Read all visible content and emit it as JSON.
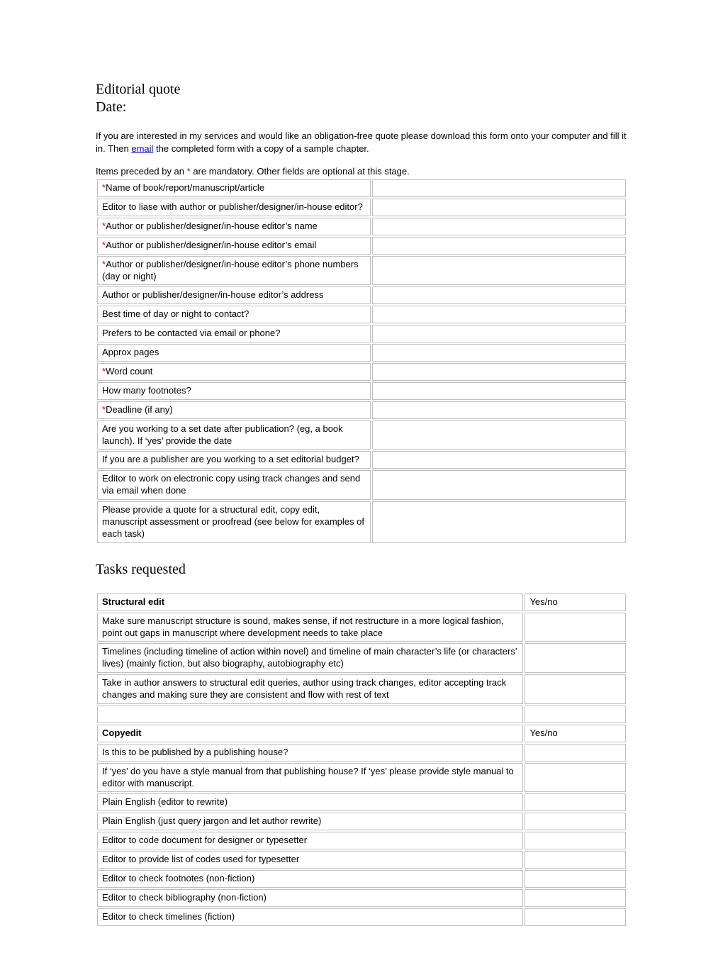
{
  "header": {
    "title": "Editorial quote",
    "date_label": "Date:"
  },
  "intro": {
    "text_before": "If you are interested in my services and would like an obligation-free quote please download this form onto your computer and fill it in. Then ",
    "link_text": "email",
    "text_after": " the completed form with a copy of a sample chapter."
  },
  "mandatory": {
    "before": "Items preceded by an ",
    "mark": "*",
    "after": " are mandatory. Other fields are optional at this stage."
  },
  "form_rows": [
    {
      "mandatory": true,
      "label": "Name of book/report/manuscript/article",
      "value": ""
    },
    {
      "mandatory": false,
      "label": "Editor to liase with author or publisher/designer/in-house editor?",
      "value": ""
    },
    {
      "mandatory": true,
      "label": "Author or publisher/designer/in-house editor’s name",
      "value": ""
    },
    {
      "mandatory": true,
      "label": "Author or publisher/designer/in-house editor’s email",
      "value": ""
    },
    {
      "mandatory": true,
      "label": "Author or publisher/designer/in-house editor’s phone numbers (day or night)",
      "value": ""
    },
    {
      "mandatory": false,
      "label": "Author or publisher/designer/in-house editor’s address",
      "value": ""
    },
    {
      "mandatory": false,
      "label": "Best time of day or night to contact?",
      "value": ""
    },
    {
      "mandatory": false,
      "label": "Prefers to be contacted via email or phone?",
      "value": ""
    },
    {
      "mandatory": false,
      "label": "Approx pages",
      "value": ""
    },
    {
      "mandatory": true,
      "label": "Word count",
      "value": ""
    },
    {
      "mandatory": false,
      "label": "How many footnotes?",
      "value": ""
    },
    {
      "mandatory": true,
      "label": "Deadline (if any)",
      "value": ""
    },
    {
      "mandatory": false,
      "label": "Are you working to a set date after publication? (eg, a book launch). If ‘yes’ provide the date",
      "value": ""
    },
    {
      "mandatory": false,
      "label": "If you are a publisher are you working to a set editorial budget?",
      "value": ""
    },
    {
      "mandatory": false,
      "label": "Editor to work on electronic copy using track changes and send via email when done",
      "value": ""
    },
    {
      "mandatory": false,
      "label": "Please provide a quote for a structural edit, copy edit, manuscript assessment or proofread (see below for examples of each task)",
      "value": ""
    }
  ],
  "tasks_header": "Tasks requested",
  "tasks": {
    "structural": {
      "title": "Structural edit",
      "yn_header": "Yes/no",
      "rows": [
        "Make sure manuscript structure is sound, makes sense, if not restructure in a more logical fashion, point out gaps in manuscript where development needs to take place",
        "Timelines (including timeline of action within novel) and timeline of main character’s life (or characters’ lives) (mainly fiction, but also biography, autobiography etc)",
        "Take in author answers to structural edit queries, author using track changes, editor accepting track changes and making sure they are consistent and flow with rest of text"
      ]
    },
    "copyedit": {
      "title": "Copyedit",
      "yn_header": "Yes/no",
      "rows": [
        "Is this to be published by a publishing house?",
        "If ‘yes’ do you have a style manual from that publishing house? If ‘yes’ please provide style manual to editor with manuscript.",
        "Plain English (editor to rewrite)",
        "Plain English (just query jargon and let author rewrite)",
        "Editor to code document for designer or typesetter",
        "Editor to provide list of codes used for typesetter",
        "Editor to check footnotes (non-fiction)",
        "Editor to check bibliography (non-fiction)",
        "Editor to check timelines (fiction)"
      ]
    }
  }
}
